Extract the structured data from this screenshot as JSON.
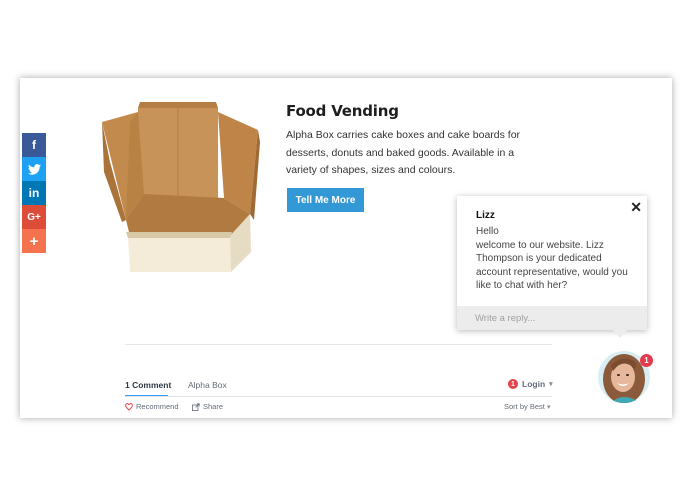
{
  "share": {
    "facebook": "f",
    "twitter": "twitter-icon",
    "linkedin": "in",
    "google_plus": "G+",
    "more": "+"
  },
  "product": {
    "title": "Food Vending",
    "description": "Alpha Box carries cake boxes and cake boards for desserts, donuts and baked goods. Available in a variety of shapes, sizes and colours.",
    "cta_label": "Tell Me More",
    "image_icon": "open-cake-box"
  },
  "comments": {
    "tab_comments": "1 Comment",
    "tab_forum": "Alpha Box",
    "login_label": "Login",
    "notif_count": "1",
    "recommend_label": "Recommend",
    "share_label": "Share",
    "sort_label": "Sort by Best"
  },
  "chat": {
    "agent_name": "Lizz",
    "message": "Hello\nwelcome to our website. Lizz Thompson is your dedicated account representative, would you like to chat with her?",
    "reply_placeholder": "Write a reply...",
    "close_icon": "close-icon",
    "badge_count": "1"
  },
  "colors": {
    "facebook": "#3b5998",
    "twitter": "#1da1f2",
    "linkedin": "#0077b5",
    "google_plus": "#dd4b39",
    "more": "#f4724e",
    "cta": "#3399d6",
    "badge": "#e23b4b"
  }
}
